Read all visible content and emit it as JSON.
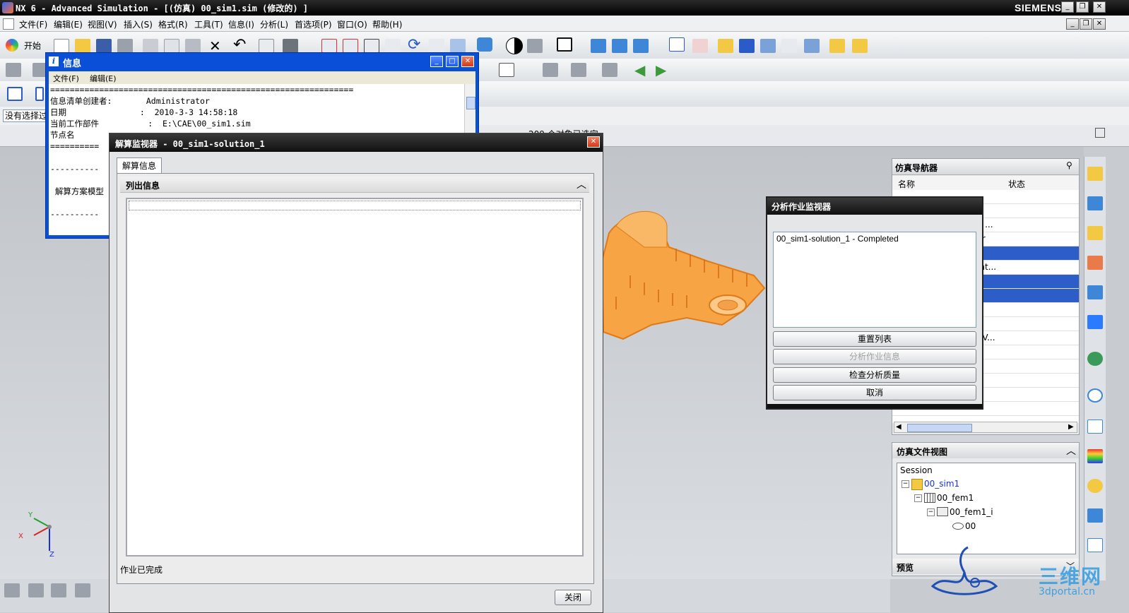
{
  "app": {
    "title": "NX 6 - Advanced Simulation - [(仿真) 00_sim1.sim (修改的) ]",
    "brand": "SIEMENS"
  },
  "menubar": {
    "items": [
      "文件(F)",
      "编辑(E)",
      "视图(V)",
      "插入(S)",
      "格式(R)",
      "工具(T)",
      "信息(I)",
      "分析(L)",
      "首选项(P)",
      "窗口(O)",
      "帮助(H)"
    ]
  },
  "toolbar": {
    "start_label": "开始",
    "selection_filter": "没有选择过",
    "status_text": "209 个对象已选定"
  },
  "info_window": {
    "title": "信息",
    "menu": [
      "文件(F)",
      "编辑(E)"
    ],
    "lines": [
      "==============================================================",
      "信息清单创建者:       Administrator",
      "日期               :  2010-3-3 14:58:18",
      "当前工作部件          :  E:\\CAE\\00_sim1.sim",
      "节点名",
      "==========",
      "",
      "----------",
      "",
      " 解算方案模型",
      "",
      "----------"
    ]
  },
  "solve_monitor": {
    "title": "解算监视器 - 00_sim1-solution_1",
    "tab": "解算信息",
    "section_header": "列出信息",
    "status": "作业已完成",
    "close_button": "关闭"
  },
  "job_monitor": {
    "title": "分析作业监视器",
    "list_items": [
      "00_sim1-solution_1 - Completed"
    ],
    "buttons": [
      "重置列表",
      "分析作业信息",
      "检查分析质量",
      "取消"
    ]
  },
  "sim_navigator": {
    "title": "仿真导航器",
    "columns": [
      "名称",
      "状态"
    ],
    "partial_rows": [
      "",
      "",
      "ct ...",
      "ier",
      "",
      "ont...",
      "",
      "",
      "",
      "d V..."
    ]
  },
  "sim_file_view": {
    "title": "仿真文件视图",
    "tree": [
      "Session",
      "00_sim1",
      "00_fem1",
      "00_fem1_i",
      "00"
    ],
    "preview_label": "预览"
  },
  "axes": {
    "x": "X",
    "y": "Y",
    "z": "Z"
  },
  "watermark": {
    "text": "三维网",
    "url_text": "3dportal.cn"
  },
  "colors": {
    "model": "#f7a445",
    "selection": "#2d5dc8",
    "info_title": "#0a4fd8"
  }
}
